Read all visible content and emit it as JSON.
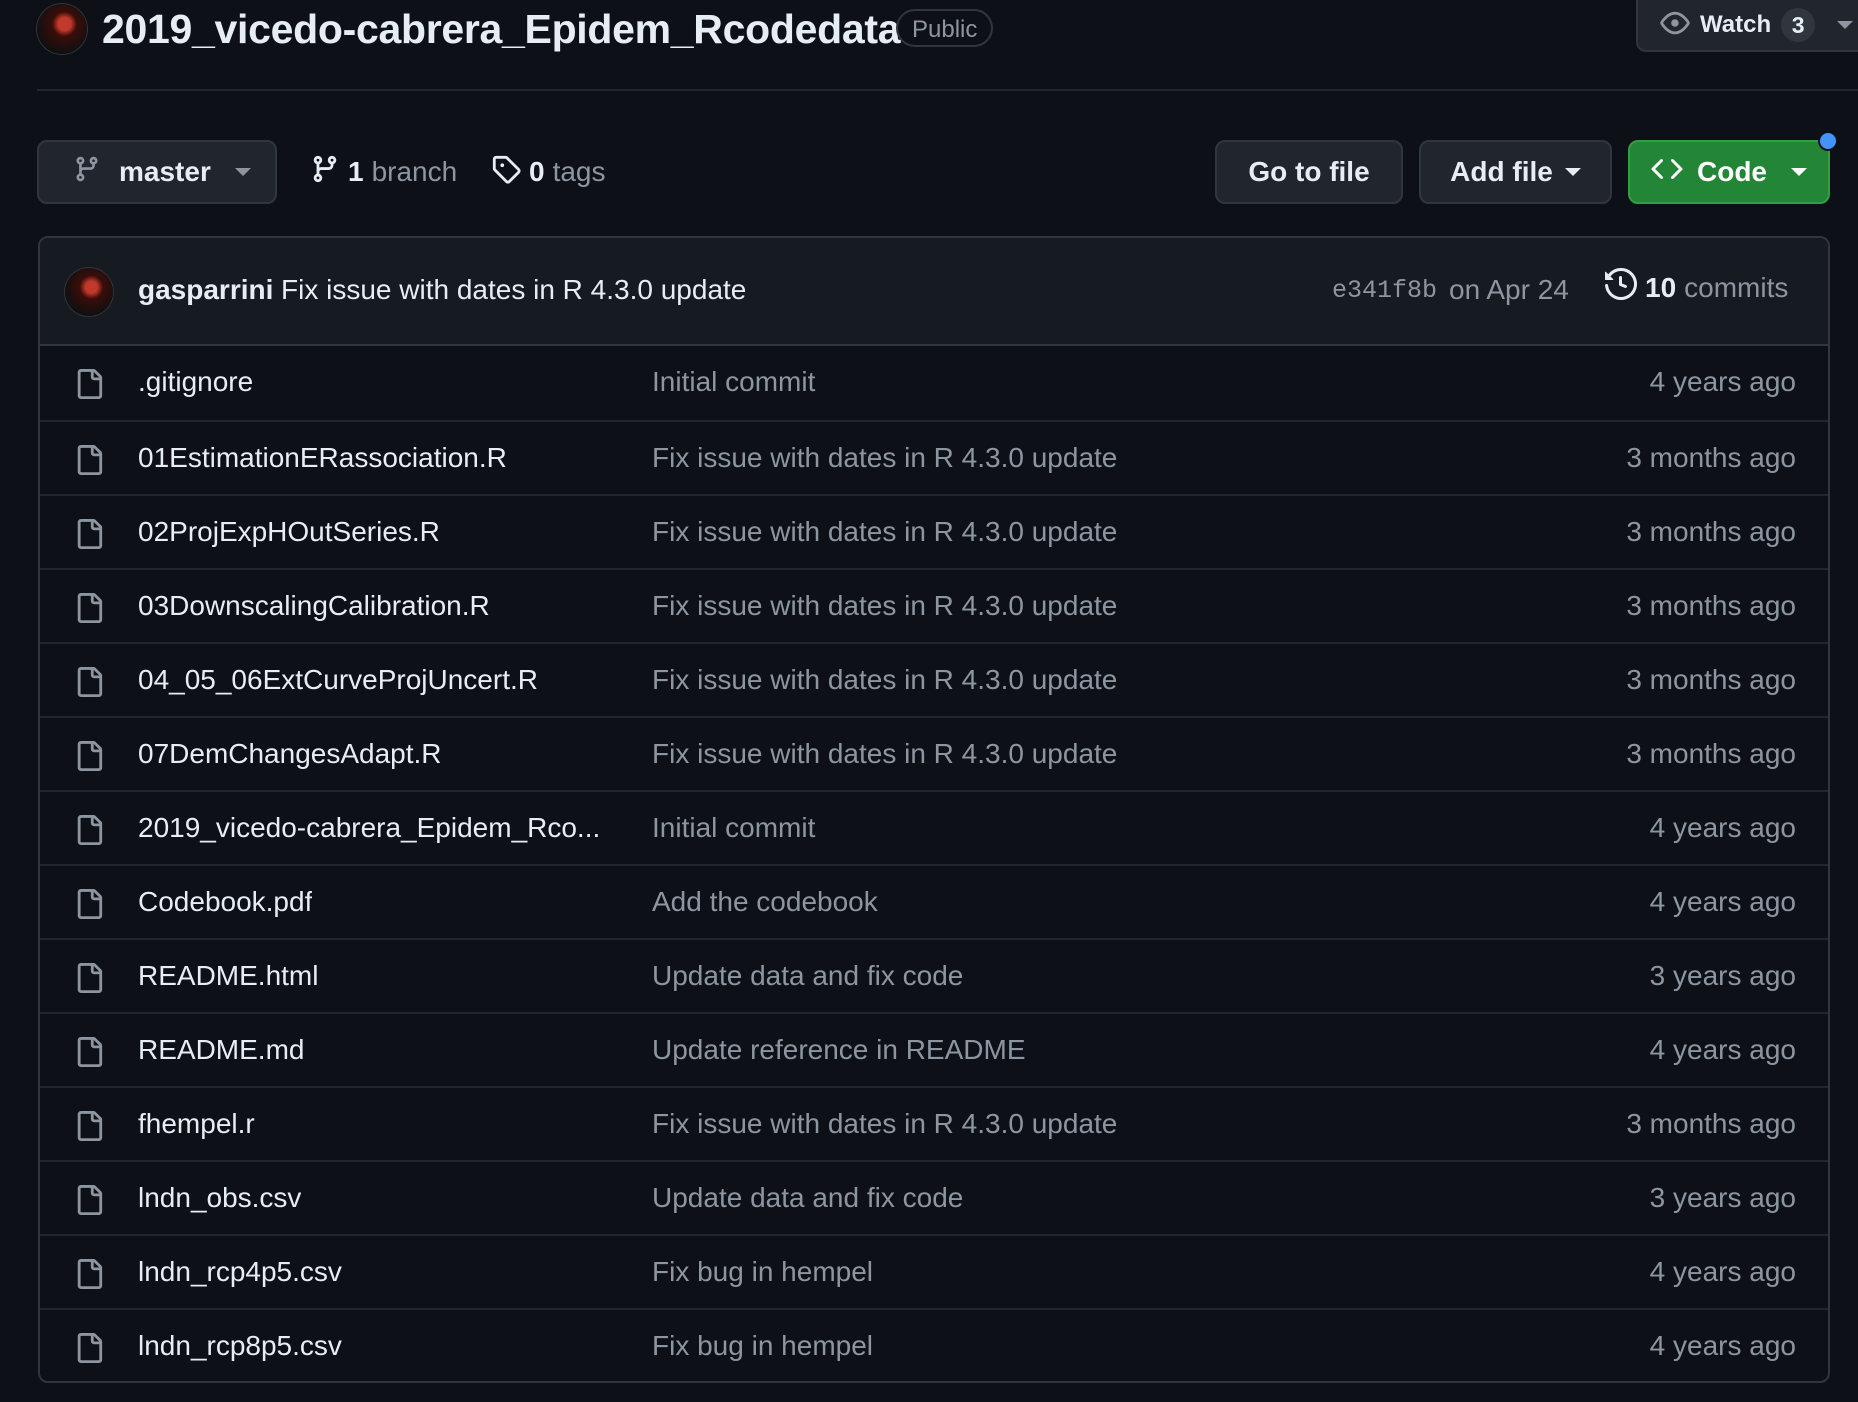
{
  "repo": {
    "name": "2019_vicedo-cabrera_Epidem_Rcodedata",
    "visibility": "Public"
  },
  "watch": {
    "label": "Watch",
    "count": "3"
  },
  "toolbar": {
    "branch_name": "master",
    "branches_count": "1",
    "branches_label": "branch",
    "tags_count": "0",
    "tags_label": "tags",
    "goto_file": "Go to file",
    "add_file": "Add file",
    "code": "Code"
  },
  "latest_commit": {
    "author": "gasparrini",
    "message": "Fix issue with dates in R 4.3.0 update",
    "sha": "e341f8b",
    "date": "on Apr 24",
    "count": "10",
    "count_label": "commits"
  },
  "files": [
    {
      "name": ".gitignore",
      "message": "Initial commit",
      "age": "4 years ago"
    },
    {
      "name": "01EstimationERassociation.R",
      "message": "Fix issue with dates in R 4.3.0 update",
      "age": "3 months ago"
    },
    {
      "name": "02ProjExpHOutSeries.R",
      "message": "Fix issue with dates in R 4.3.0 update",
      "age": "3 months ago"
    },
    {
      "name": "03DownscalingCalibration.R",
      "message": "Fix issue with dates in R 4.3.0 update",
      "age": "3 months ago"
    },
    {
      "name": "04_05_06ExtCurveProjUncert.R",
      "message": "Fix issue with dates in R 4.3.0 update",
      "age": "3 months ago"
    },
    {
      "name": "07DemChangesAdapt.R",
      "message": "Fix issue with dates in R 4.3.0 update",
      "age": "3 months ago"
    },
    {
      "name": "2019_vicedo-cabrera_Epidem_Rco...",
      "message": "Initial commit",
      "age": "4 years ago"
    },
    {
      "name": "Codebook.pdf",
      "message": "Add the codebook",
      "age": "4 years ago"
    },
    {
      "name": "README.html",
      "message": "Update data and fix code",
      "age": "3 years ago"
    },
    {
      "name": "README.md",
      "message": "Update reference in README",
      "age": "4 years ago"
    },
    {
      "name": "fhempel.r",
      "message": "Fix issue with dates in R 4.3.0 update",
      "age": "3 months ago"
    },
    {
      "name": "lndn_obs.csv",
      "message": "Update data and fix code",
      "age": "3 years ago"
    },
    {
      "name": "lndn_rcp4p5.csv",
      "message": "Fix bug in hempel",
      "age": "4 years ago"
    },
    {
      "name": "lndn_rcp8p5.csv",
      "message": "Fix bug in hempel",
      "age": "4 years ago"
    }
  ],
  "colors": {
    "background": "#0d1117",
    "border": "#30363d",
    "muted_text": "#8d96a0",
    "primary_button": "#238636",
    "notification_dot": "#4493f8"
  }
}
